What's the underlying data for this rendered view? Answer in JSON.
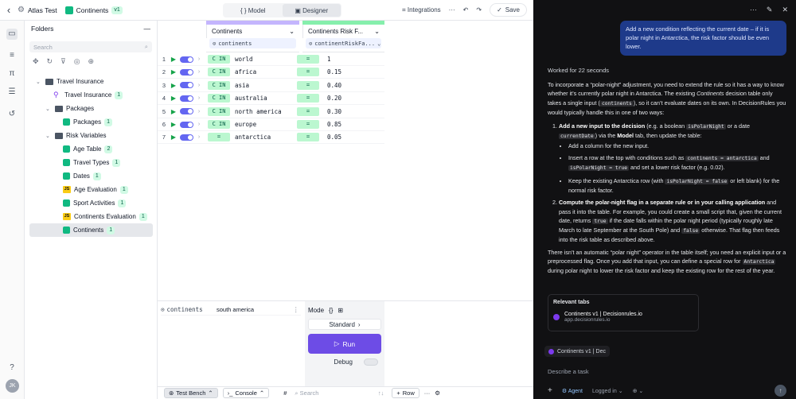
{
  "topbar": {
    "project": "Atlas Test",
    "doc_title": "Continents",
    "version": "v1",
    "tab_model": "Model",
    "tab_designer": "Designer",
    "integrations": "Integrations",
    "more": "···",
    "save": "Save"
  },
  "folders": {
    "title": "Folders",
    "collapse": "—",
    "search_placeholder": "Search",
    "tree": [
      {
        "label": "Travel Insurance",
        "icon": "folder",
        "badge": ""
      },
      {
        "label": "Travel Insurance",
        "icon": "flow",
        "badge": "1"
      },
      {
        "label": "Packages",
        "icon": "folder",
        "badge": ""
      },
      {
        "label": "Packages",
        "icon": "table",
        "badge": "1"
      },
      {
        "label": "Risk Variables",
        "icon": "folder",
        "badge": ""
      },
      {
        "label": "Age Table",
        "icon": "table",
        "badge": "2"
      },
      {
        "label": "Travel Types",
        "icon": "table",
        "badge": "1"
      },
      {
        "label": "Dates",
        "icon": "table",
        "badge": "1"
      },
      {
        "label": "Age Evaluation",
        "icon": "js",
        "badge": "1"
      },
      {
        "label": "Sport Activities",
        "icon": "table",
        "badge": "1"
      },
      {
        "label": "Continents Evaluation",
        "icon": "js",
        "badge": "1"
      },
      {
        "label": "Continents",
        "icon": "table",
        "badge": "1"
      }
    ]
  },
  "table": {
    "input_col": {
      "title": "Continents",
      "binding": "continents"
    },
    "output_col": {
      "title": "Continents Risk F...",
      "binding": "continentRiskFa..."
    },
    "rows": [
      {
        "n": "1",
        "op": "C IN",
        "value": "world",
        "op2": "=",
        "out": "1"
      },
      {
        "n": "2",
        "op": "C IN",
        "value": "africa",
        "op2": "=",
        "out": "0.15"
      },
      {
        "n": "3",
        "op": "C IN",
        "value": "asia",
        "op2": "=",
        "out": "0.40"
      },
      {
        "n": "4",
        "op": "C IN",
        "value": "australia",
        "op2": "=",
        "out": "0.20"
      },
      {
        "n": "5",
        "op": "C IN",
        "value": "north america",
        "op2": "=",
        "out": "0.30"
      },
      {
        "n": "6",
        "op": "C IN",
        "value": "europe",
        "op2": "=",
        "out": "0.85"
      },
      {
        "n": "7",
        "op": "=",
        "value": "antarctica",
        "op2": "=",
        "out": "0.05"
      }
    ]
  },
  "bench": {
    "input_name": "continents",
    "input_value": "south america",
    "mode_label": "Mode",
    "mode_value": "Standard",
    "run": "Run",
    "debug": "Debug"
  },
  "bottombar": {
    "test_bench": "Test Bench",
    "console": "Console",
    "search_placeholder": "Search",
    "add_row": "Row"
  },
  "chat": {
    "user_message": "Add a new condition reflecting the current date – if it is polar night in Antarctica, the risk factor should be even lower.",
    "worked": "Worked for 22 seconds",
    "intro_1": "To incorporate a “polar-night” adjustment, you need to extend the rule so it has a way to know whether it’s currently polar night in Antarctica. The existing ",
    "intro_em": "Continents",
    "intro_2": " decision table only takes a single input (",
    "intro_code": "continents",
    "intro_3": "), so it can’t evaluate dates on its own. In DecisionRules you would typically handle this in one of two ways:",
    "o1_b": "Add a new input to the decision",
    "o1_a": " (e.g. a boolean ",
    "o1_c1": "isPolarNight",
    "o1_b2": " or a date ",
    "o1_c2": "currentDate",
    "o1_c": ") via the ",
    "o1_m": "Model",
    "o1_d": " tab, then update the table:",
    "b1": "Add a column for the new input.",
    "b2_a": "Insert a row at the top with conditions such as ",
    "b2_c1": "continents = antarctica",
    "b2_b": " and ",
    "b2_c2": "isPolarNight = true",
    "b2_c": " and set a lower risk factor (e.g. 0.02).",
    "b3_a": "Keep the existing Antarctica row (with ",
    "b3_c": "isPolarNight = false",
    "b3_b": " or left blank) for the normal risk factor.",
    "o2_b": "Compute the polar-night flag in a separate rule or in your calling application",
    "o2_a": " and pass it into the table. For example, you could create a small script that, given the current date, returns ",
    "o2_c1": "true",
    "o2_m": " if the date falls within the polar night period (typically roughly late March to late September at the South Pole) and ",
    "o2_c2": "false",
    "o2_e": " otherwise. That flag then feeds into the risk table as described above.",
    "outro_1": "There isn’t an automatic “polar night” operator in the table itself; you need an explicit input or a preprocessed flag. Once you add that input, you can define a special row for ",
    "outro_code": "Antarctica",
    "outro_2": " during polar night to lower the risk factor and keep the existing row for the rest of the year.",
    "relevant_title": "Relevant tabs",
    "relevant_item": "Continents v1 | Decisionrules.io",
    "relevant_url": "app.decisionrules.io",
    "context_chip": "Continents v1 | Dec",
    "task_placeholder": "Describe a task",
    "agent": "Agent",
    "logged_in": "Logged in"
  }
}
